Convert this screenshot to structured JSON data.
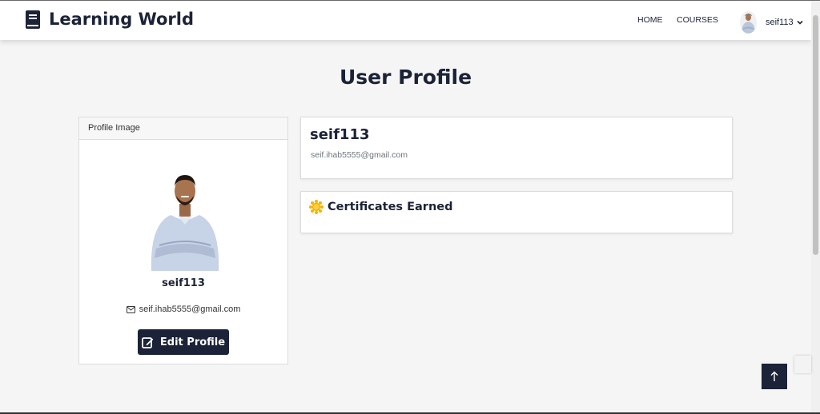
{
  "brand": {
    "name": "Learning World",
    "icon": "book-icon"
  },
  "nav": {
    "home_label": "HOME",
    "courses_label": "COURSES",
    "user_name": "seif113"
  },
  "page": {
    "title": "User Profile"
  },
  "profile_card": {
    "header": "Profile Image",
    "username": "seif113",
    "email": "seif.ihab5555@gmail.com",
    "edit_label": "Edit Profile"
  },
  "info_card": {
    "username": "seif113",
    "email": "seif.ihab5555@gmail.com"
  },
  "certificates": {
    "title": "Certificates Earned",
    "icon": "sun-badge-icon"
  },
  "colors": {
    "primary": "#1c2237",
    "background": "#f5f5f5",
    "muted_text": "#6c757d",
    "badge": "#f5b301"
  }
}
